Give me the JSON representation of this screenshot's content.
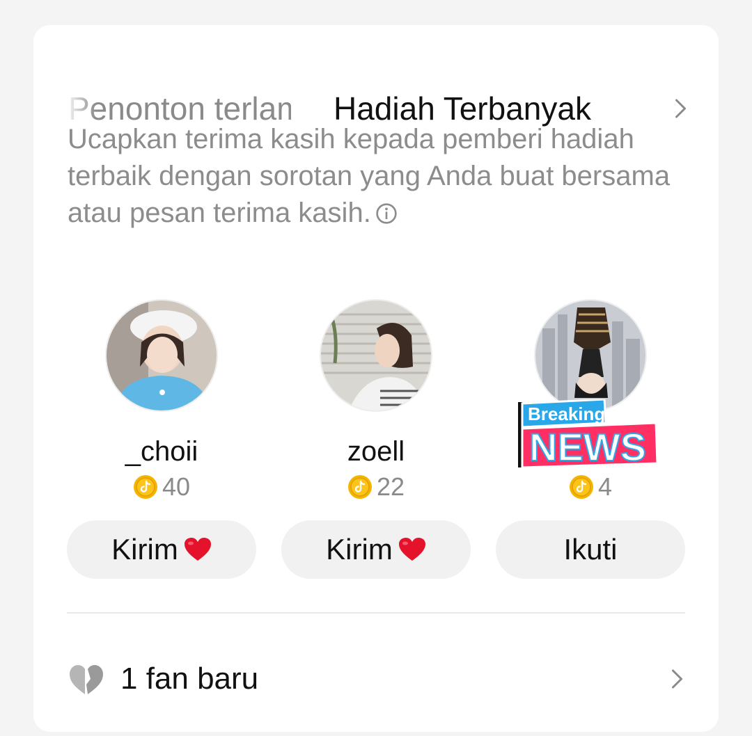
{
  "tabs": {
    "previous_label": "Penonton terlama",
    "active_label": "Hadiah Terbanyak",
    "chevron_icon": "chevron-right-icon"
  },
  "description": "Ucapkan terima kasih kepada pemberi hadiah terbaik dengan sorotan yang Anda buat bersama atau pesan terima kasih.",
  "info_icon": "info-circle-icon",
  "gifters": [
    {
      "name": "_choii",
      "coins": "40",
      "button_label": "Kirim",
      "button_icon": "red-heart-emoji",
      "avatar": "avatar-photo-girl-white-hat"
    },
    {
      "name": "zoell",
      "coins": "22",
      "button_label": "Kirim",
      "button_icon": "red-heart-emoji",
      "avatar": "avatar-photo-short-hair"
    },
    {
      "name": "",
      "coins": "4",
      "button_label": "Ikuti",
      "avatar": "avatar-photo-upside-down-figure"
    }
  ],
  "badge": {
    "top": "Breaking",
    "bottom": "NEWS"
  },
  "coin_icon": "tiktok-coin-icon",
  "fans": {
    "label": "1 fan baru",
    "icon": "grey-heart-icon",
    "chevron_icon": "chevron-right-icon"
  },
  "colors": {
    "background": "#f4f4f4",
    "card": "#ffffff",
    "button": "#f1f1f2",
    "muted_text": "#8c8c8c",
    "coin": "#f5b400",
    "heart": "#e5122c",
    "badge_pink": "#ff2e63",
    "badge_blue": "#2aa7e8"
  }
}
